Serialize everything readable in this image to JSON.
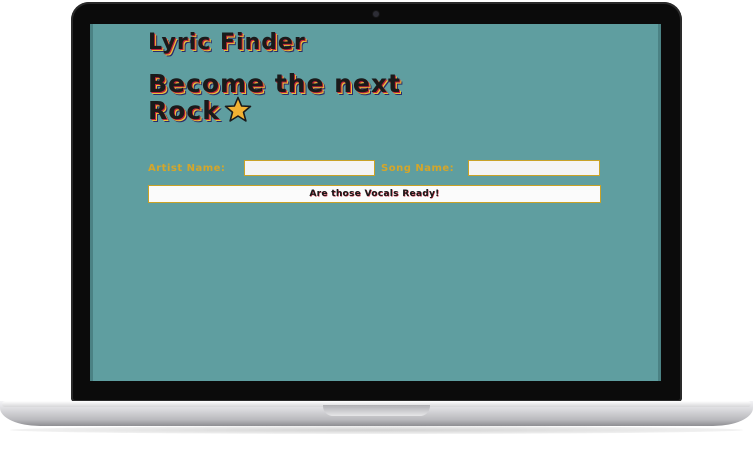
{
  "app": {
    "title": "Lyric Finder",
    "headline_line1": "Become the next",
    "headline_line2": "Rock"
  },
  "form": {
    "artist_label": "Artist Name:",
    "artist_value": "",
    "song_label": "Song Name:",
    "song_value": "",
    "submit_label": "Are those Vocals Ready!"
  },
  "icons": {
    "headline_icon": "star-icon"
  },
  "colors": {
    "screen_background": "#5f9ea0",
    "label_text": "#d4a62a",
    "input_border": "#c9a227",
    "star_fill": "#f2b233",
    "heading_shadow_red": "#c0243a"
  }
}
